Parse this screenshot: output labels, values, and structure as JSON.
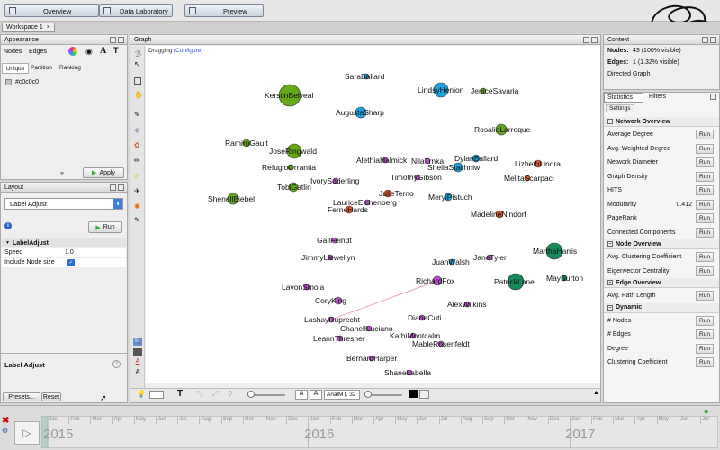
{
  "top_tabs": {
    "overview": "Overview",
    "data_lab": "Data Laboratory",
    "preview": "Preview"
  },
  "workspace": {
    "tab": "Workspace 1"
  },
  "appearance": {
    "header": "Appearance",
    "tabs": [
      "Nodes",
      "Edges"
    ],
    "subtabs": [
      "Unique",
      "Partition",
      "Ranking"
    ],
    "color_value": "#c0c0c0",
    "apply": "Apply"
  },
  "layout_panel": {
    "header": "Layout",
    "algorithm": "Label Adjust",
    "run": "Run",
    "section": "LabelAdjust",
    "props": [
      {
        "name": "Speed",
        "value": "1.0"
      },
      {
        "name": "Include Node size",
        "value": "checked"
      }
    ],
    "desc_title": "Label Adjust",
    "presets": "Presets...",
    "reset": "Reset"
  },
  "graph": {
    "header": "Graph",
    "mode": "Dragging",
    "configure": "(Configure)",
    "font": "ArialMT, 32",
    "nodes": [
      {
        "label": "SaraBallard",
        "color": "#1a8fd8",
        "r": 3
      },
      {
        "label": "KerstinBelveal",
        "color": "#66a818",
        "r": 12
      },
      {
        "label": "LindsyHenion",
        "color": "#1aa3e0",
        "r": 8
      },
      {
        "label": "JeniceSavaria",
        "color": "#66a818",
        "r": 3
      },
      {
        "label": "AugustaSharp",
        "color": "#1aa3e0",
        "r": 6
      },
      {
        "label": "RosaliaLarroque",
        "color": "#66a818",
        "r": 6
      },
      {
        "label": "RamiroGault",
        "color": "#66a818",
        "r": 4
      },
      {
        "label": "JoseRingwald",
        "color": "#66a818",
        "r": 8
      },
      {
        "label": "RefugioOrrantia",
        "color": "#66a818",
        "r": 3
      },
      {
        "label": "AlethiaHalmick",
        "color": "#b84fc7",
        "r": 3
      },
      {
        "label": "NilaTrnka",
        "color": "#b84fc7",
        "r": 3
      },
      {
        "label": "DylanBallard",
        "color": "#1aa3e0",
        "r": 4
      },
      {
        "label": "SheilaStachniw",
        "color": "#1aa3e0",
        "r": 5
      },
      {
        "label": "LizbethLindra",
        "color": "#e05a28",
        "r": 4
      },
      {
        "label": "IvorySoderling",
        "color": "#b84fc7",
        "r": 3
      },
      {
        "label": "TimothyGibson",
        "color": "#b84fc7",
        "r": 3
      },
      {
        "label": "MelitaScarpaci",
        "color": "#e05a28",
        "r": 3
      },
      {
        "label": "TobiGatlin",
        "color": "#66a818",
        "r": 5
      },
      {
        "label": "JulieTerno",
        "color": "#e05a28",
        "r": 4
      },
      {
        "label": "MerylPistuch",
        "color": "#1aa3e0",
        "r": 4
      },
      {
        "label": "ShenellBiebel",
        "color": "#66a818",
        "r": 6
      },
      {
        "label": "LauriceEichenberg",
        "color": "#b84fc7",
        "r": 3
      },
      {
        "label": "FerneHards",
        "color": "#e05a28",
        "r": 4
      },
      {
        "label": "MadelineNindorf",
        "color": "#e05a28",
        "r": 4
      },
      {
        "label": "GailFeindt",
        "color": "#b84fc7",
        "r": 3
      },
      {
        "label": "MarthaHarris",
        "color": "#158a5a",
        "r": 9
      },
      {
        "label": "JimmyLlewellyn",
        "color": "#b84fc7",
        "r": 3
      },
      {
        "label": "JuanWalsh",
        "color": "#1aa3e0",
        "r": 3
      },
      {
        "label": "JaneTyler",
        "color": "#b84fc7",
        "r": 3
      },
      {
        "label": "RichardFox",
        "color": "#b84fc7",
        "r": 5
      },
      {
        "label": "PatrickLane",
        "color": "#158a5a",
        "r": 9
      },
      {
        "label": "MaySurton",
        "color": "#158a5a",
        "r": 3
      },
      {
        "label": "LavonSmola",
        "color": "#b84fc7",
        "r": 3
      },
      {
        "label": "CoryKing",
        "color": "#b84fc7",
        "r": 4
      },
      {
        "label": "AlexWilkins",
        "color": "#b84fc7",
        "r": 3
      },
      {
        "label": "LashayRuprecht",
        "color": "#b84fc7",
        "r": 3
      },
      {
        "label": "DianeCuti",
        "color": "#b84fc7",
        "r": 3
      },
      {
        "label": "ChanellLuciano",
        "color": "#b84fc7",
        "r": 3
      },
      {
        "label": "KathiMontcalm",
        "color": "#b84fc7",
        "r": 3
      },
      {
        "label": "LeannThresher",
        "color": "#b84fc7",
        "r": 3
      },
      {
        "label": "MableRosenfeldt",
        "color": "#b84fc7",
        "r": 3
      },
      {
        "label": "BernardHarper",
        "color": "#b84fc7",
        "r": 3
      },
      {
        "label": "ShaneLabella",
        "color": "#b84fc7",
        "r": 3
      }
    ]
  },
  "context": {
    "header": "Context",
    "nodes": "Nodes:",
    "nodes_val": "43 (100% visible)",
    "edges": "Edges:",
    "edges_val": "1 (1.32% visible)",
    "type": "Directed Graph"
  },
  "statistics": {
    "tabs": [
      "Statistics",
      "Filters"
    ],
    "settings": "Settings",
    "run": "Run",
    "modularity_value": "0.412",
    "sections": [
      {
        "title": "Network Overview",
        "items": [
          "Average Degree",
          "Avg. Weighted Degree",
          "Network Diameter",
          "Graph Density",
          "HITS",
          "Modularity",
          "PageRank",
          "Connected Components"
        ]
      },
      {
        "title": "Node Overview",
        "items": [
          "Avg. Clustering Coefficient",
          "Eigenvector Centrality"
        ]
      },
      {
        "title": "Edge Overview",
        "items": [
          "Avg. Path Length"
        ]
      },
      {
        "title": "Dynamic",
        "items": [
          "# Nodes",
          "# Edges",
          "Degree",
          "Clustering Coefficient"
        ]
      }
    ]
  },
  "timeline": {
    "months": [
      "Jan",
      "Feb",
      "Mar",
      "Apr",
      "May",
      "Jun",
      "Jul",
      "Aug",
      "Sep",
      "Oct",
      "Nov",
      "Dec"
    ],
    "years": [
      "2015",
      "2016",
      "2017"
    ]
  }
}
